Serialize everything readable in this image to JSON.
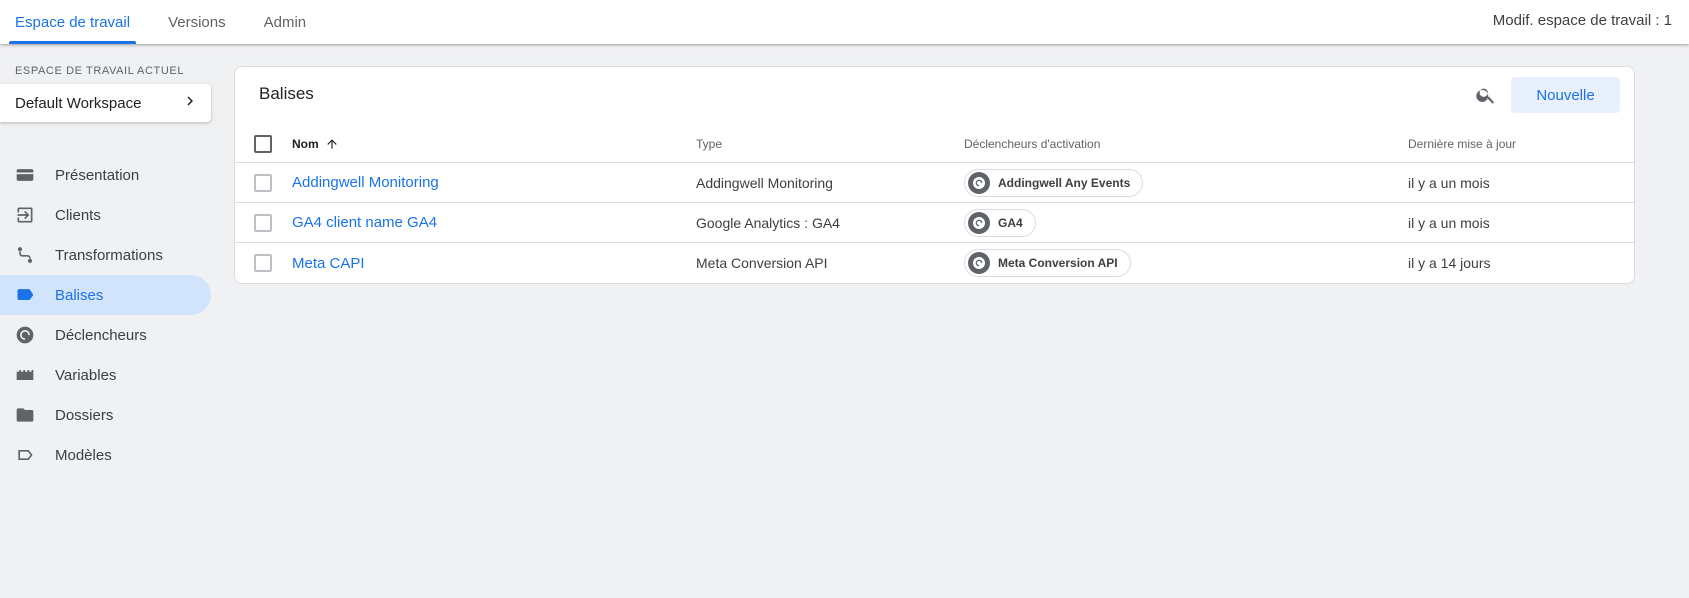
{
  "header": {
    "tabs": [
      {
        "label": "Espace de travail",
        "active": true
      },
      {
        "label": "Versions",
        "active": false
      },
      {
        "label": "Admin",
        "active": false
      }
    ],
    "workspace_changes": "Modif. espace de travail : 1"
  },
  "sidebar": {
    "workspace_caption": "ESPACE DE TRAVAIL ACTUEL",
    "workspace_name": "Default Workspace",
    "items": [
      {
        "label": "Présentation",
        "icon": "overview-icon"
      },
      {
        "label": "Clients",
        "icon": "clients-icon"
      },
      {
        "label": "Transformations",
        "icon": "transformations-icon"
      },
      {
        "label": "Balises",
        "icon": "tag-icon",
        "active": true
      },
      {
        "label": "Déclencheurs",
        "icon": "trigger-icon"
      },
      {
        "label": "Variables",
        "icon": "variables-icon"
      },
      {
        "label": "Dossiers",
        "icon": "folder-icon"
      },
      {
        "label": "Modèles",
        "icon": "template-icon"
      }
    ]
  },
  "main": {
    "title": "Balises",
    "new_button": "Nouvelle",
    "columns": {
      "name": "Nom",
      "type": "Type",
      "triggers": "Déclencheurs d'activation",
      "updated": "Dernière mise à jour"
    },
    "rows": [
      {
        "name": "Addingwell Monitoring",
        "type": "Addingwell Monitoring",
        "trigger": "Addingwell Any Events",
        "updated": "il y a un mois"
      },
      {
        "name": "GA4 client name GA4",
        "type": "Google Analytics : GA4",
        "trigger": "GA4",
        "updated": "il y a un mois"
      },
      {
        "name": "Meta CAPI",
        "type": "Meta Conversion API",
        "trigger": "Meta Conversion API",
        "updated": "il y a 14 jours"
      }
    ]
  },
  "colors": {
    "accent": "#1a73e8",
    "active_nav_bg": "#d2e3fc",
    "page_bg": "#f0f1f3"
  }
}
